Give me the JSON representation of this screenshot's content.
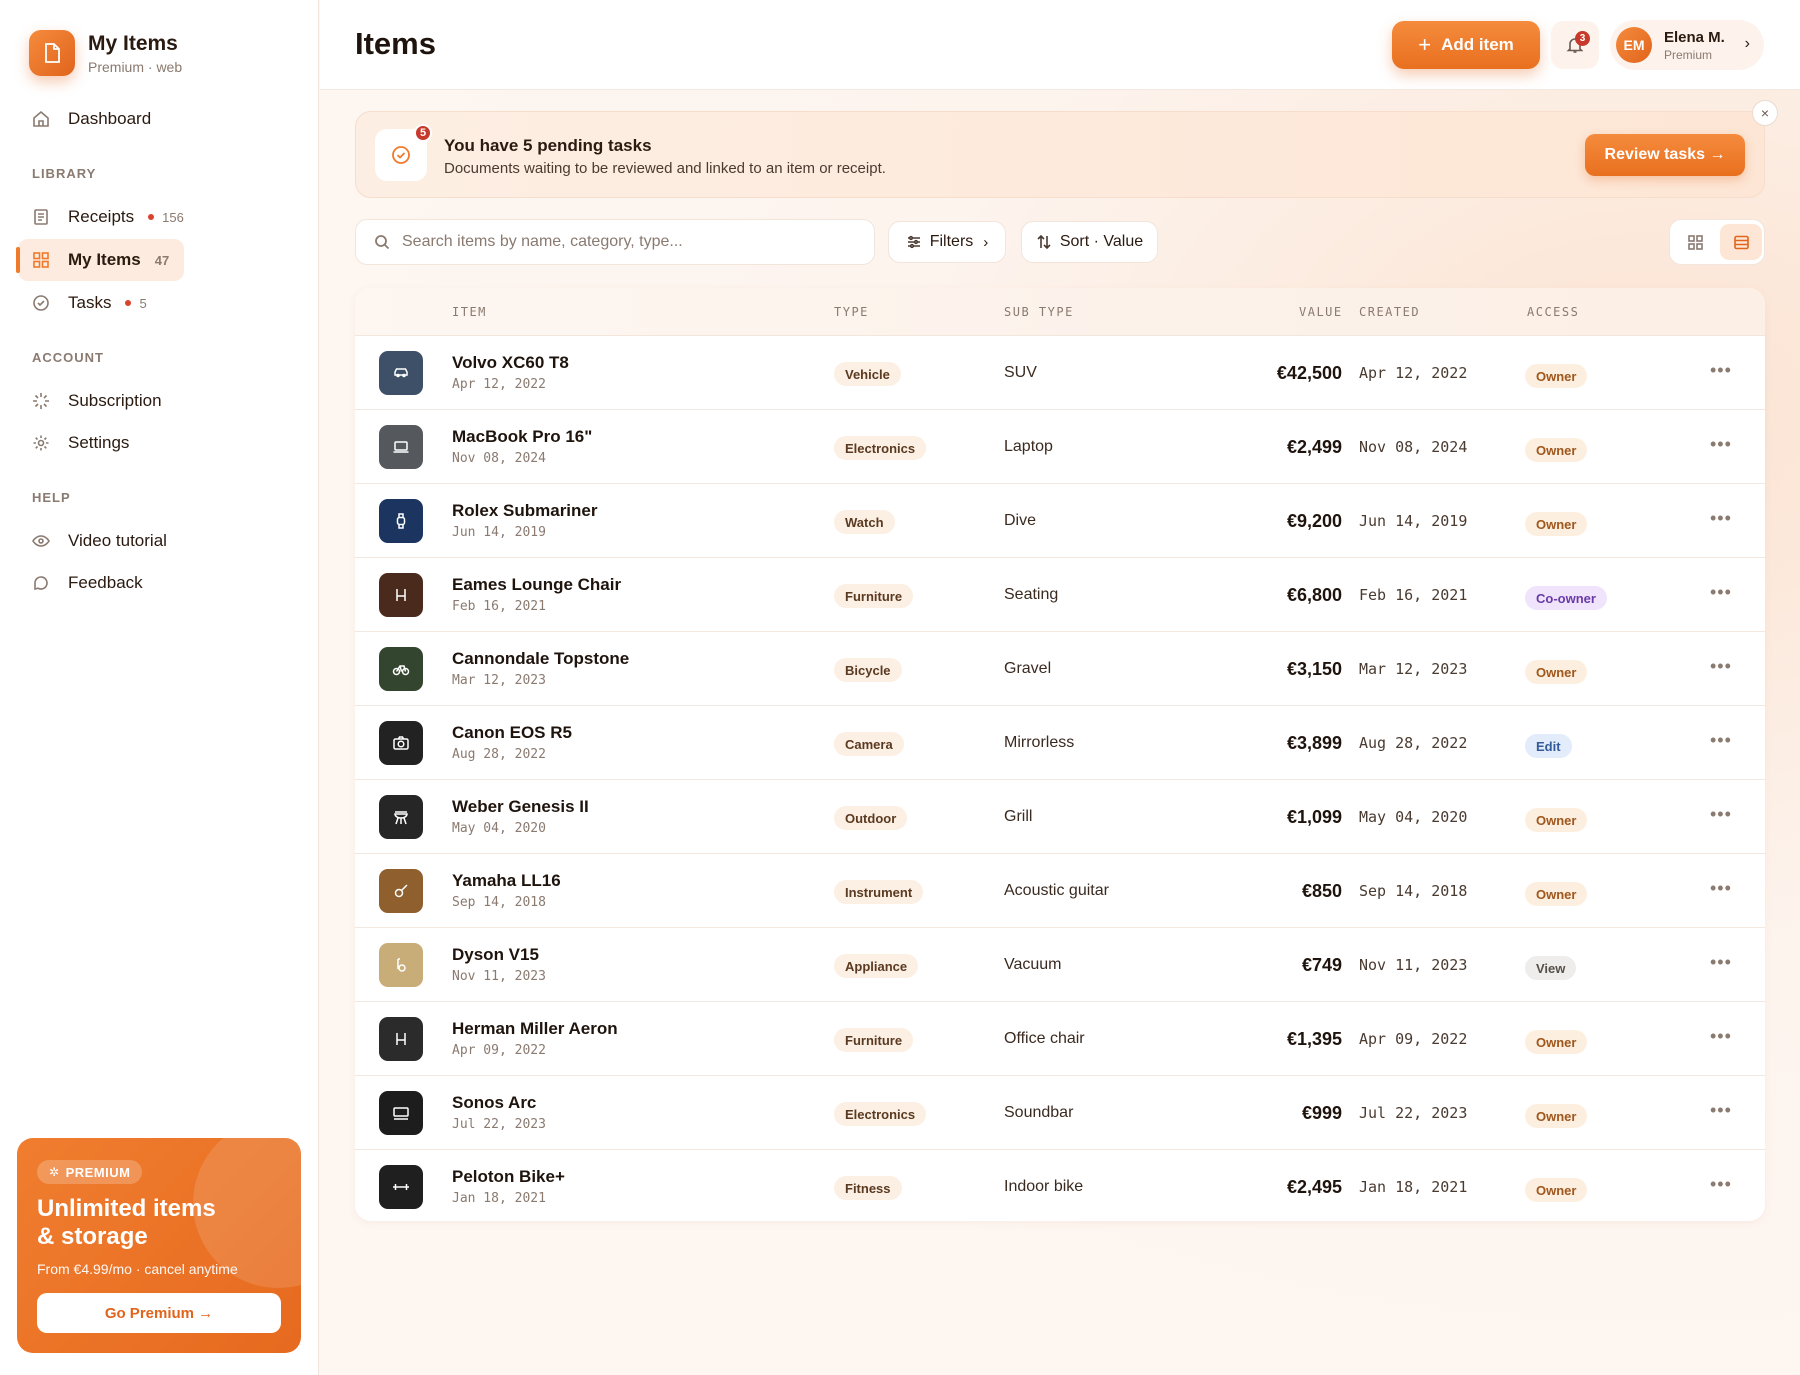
{
  "brand": {
    "title": "My Items",
    "subtitle": "Premium · web"
  },
  "sidebar": {
    "dashboard": "Dashboard",
    "library_label": "LIBRARY",
    "receipts": {
      "label": "Receipts",
      "count": "156"
    },
    "my_items": {
      "label": "My Items",
      "count": "47"
    },
    "tasks": {
      "label": "Tasks",
      "count": "5"
    },
    "account_label": "ACCOUNT",
    "subscription": "Subscription",
    "settings": "Settings",
    "help_label": "HELP",
    "video_tutorial": "Video tutorial",
    "feedback": "Feedback"
  },
  "promo": {
    "badge": "PREMIUM",
    "title": "Unlimited items & storage",
    "subtitle": "From €4.99/mo · cancel anytime",
    "button": "Go Premium →"
  },
  "header": {
    "title": "Items",
    "add_button": "Add item",
    "notifications_count": "3",
    "user": {
      "initials": "EM",
      "name": "Elena M.",
      "plan": "Premium"
    }
  },
  "banner": {
    "count": "5",
    "title": "You have 5 pending tasks",
    "subtitle": "Documents waiting to be reviewed and linked to an item or receipt.",
    "button": "Review tasks →",
    "close": "×"
  },
  "toolbar": {
    "search_placeholder": "Search items by name, category, type...",
    "filters": "Filters",
    "sort": "Sort · Value",
    "view_mode": "list"
  },
  "table": {
    "columns": {
      "item": "ITEM",
      "type": "TYPE",
      "subtype": "SUB TYPE",
      "value": "VALUE",
      "created": "CREATED",
      "access": "ACCESS"
    },
    "rows": [
      {
        "name": "Volvo XC60 T8",
        "date": "Apr 12, 2022",
        "type": "Vehicle",
        "subtype": "SUV",
        "value": "€42,500",
        "created": "Apr 12, 2022",
        "access": "Owner",
        "icon": "car-icon",
        "color": "#3d5068"
      },
      {
        "name": "MacBook Pro 16\"",
        "date": "Nov 08, 2024",
        "type": "Electronics",
        "subtype": "Laptop",
        "value": "€2,499",
        "created": "Nov 08, 2024",
        "access": "Owner",
        "icon": "laptop-icon",
        "color": "#55585c"
      },
      {
        "name": "Rolex Submariner",
        "date": "Jun 14, 2019",
        "type": "Watch",
        "subtype": "Dive",
        "value": "€9,200",
        "created": "Jun 14, 2019",
        "access": "Owner",
        "icon": "watch-icon",
        "color": "#1b3560"
      },
      {
        "name": "Eames Lounge Chair",
        "date": "Feb 16, 2021",
        "type": "Furniture",
        "subtype": "Seating",
        "value": "€6,800",
        "created": "Feb 16, 2021",
        "access": "Co-owner",
        "icon": "chair-icon",
        "color": "#4a2a1c"
      },
      {
        "name": "Cannondale Topstone",
        "date": "Mar 12, 2023",
        "type": "Bicycle",
        "subtype": "Gravel",
        "value": "€3,150",
        "created": "Mar 12, 2023",
        "access": "Owner",
        "icon": "bicycle-icon",
        "color": "#34452f"
      },
      {
        "name": "Canon EOS R5",
        "date": "Aug 28, 2022",
        "type": "Camera",
        "subtype": "Mirrorless",
        "value": "€3,899",
        "created": "Aug 28, 2022",
        "access": "Edit",
        "icon": "camera-icon",
        "color": "#222222"
      },
      {
        "name": "Weber Genesis II",
        "date": "May 04, 2020",
        "type": "Outdoor",
        "subtype": "Grill",
        "value": "€1,099",
        "created": "May 04, 2020",
        "access": "Owner",
        "icon": "grill-icon",
        "color": "#262626"
      },
      {
        "name": "Yamaha LL16",
        "date": "Sep 14, 2018",
        "type": "Instrument",
        "subtype": "Acoustic guitar",
        "value": "€850",
        "created": "Sep 14, 2018",
        "access": "Owner",
        "icon": "guitar-icon",
        "color": "#8f5f2e"
      },
      {
        "name": "Dyson V15",
        "date": "Nov 11, 2023",
        "type": "Appliance",
        "subtype": "Vacuum",
        "value": "€749",
        "created": "Nov 11, 2023",
        "access": "View",
        "icon": "vacuum-icon",
        "color": "#c9ad78"
      },
      {
        "name": "Herman Miller Aeron",
        "date": "Apr 09, 2022",
        "type": "Furniture",
        "subtype": "Office chair",
        "value": "€1,395",
        "created": "Apr 09, 2022",
        "access": "Owner",
        "icon": "chair-icon",
        "color": "#2b2b2b"
      },
      {
        "name": "Sonos Arc",
        "date": "Jul 22, 2023",
        "type": "Electronics",
        "subtype": "Soundbar",
        "value": "€999",
        "created": "Jul 22, 2023",
        "access": "Owner",
        "icon": "soundbar-icon",
        "color": "#1d1d1d"
      },
      {
        "name": "Peloton Bike+",
        "date": "Jan 18, 2021",
        "type": "Fitness",
        "subtype": "Indoor bike",
        "value": "€2,495",
        "created": "Jan 18, 2021",
        "access": "Owner",
        "icon": "dumbbell-icon",
        "color": "#1f1f1f"
      }
    ],
    "more_label": "•••"
  },
  "access_colors": {
    "Owner": {
      "bg": "#fdefdf",
      "fg": "#a0561c"
    },
    "Co-owner": {
      "bg": "#efe4fb",
      "fg": "#6a3aa8"
    },
    "Edit": {
      "bg": "#e2ecfa",
      "fg": "#355a9a"
    },
    "View": {
      "bg": "#efedeb",
      "fg": "#555049"
    }
  }
}
